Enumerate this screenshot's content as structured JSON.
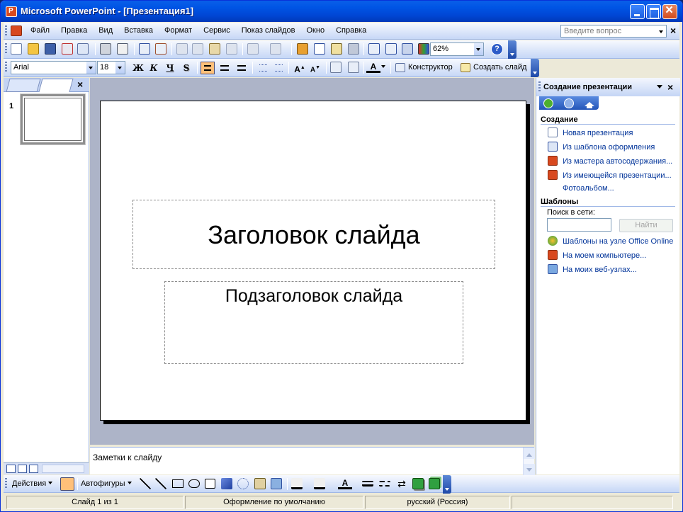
{
  "window": {
    "title": "Microsoft PowerPoint - [Презентация1]"
  },
  "menu": {
    "items": [
      "Файл",
      "Правка",
      "Вид",
      "Вставка",
      "Формат",
      "Сервис",
      "Показ слайдов",
      "Окно",
      "Справка"
    ],
    "help_placeholder": "Введите вопрос"
  },
  "toolbar": {
    "zoom": "62%",
    "font": "Arial",
    "font_size": "18",
    "bold": "Ж",
    "italic": "К",
    "underline": "Ч",
    "shadow": "S",
    "design_label": "Конструктор",
    "new_slide_label": "Создать слайд"
  },
  "slides_pane": {
    "slide_number": "1"
  },
  "slide": {
    "title_placeholder": "Заголовок слайда",
    "subtitle_placeholder": "Подзаголовок слайда"
  },
  "notes": {
    "placeholder": "Заметки к слайду"
  },
  "task_pane": {
    "title": "Создание презентации",
    "create_section": "Создание",
    "create_links": [
      "Новая презентация",
      "Из шаблона оформления",
      "Из мастера автосодержания...",
      "Из имеющейся презентации...",
      "Фотоальбом..."
    ],
    "templates_section": "Шаблоны",
    "search_label": "Поиск в сети:",
    "search_button": "Найти",
    "template_links": [
      "Шаблоны на узле Office Online",
      "На моем компьютере...",
      "На моих веб-узлах..."
    ]
  },
  "drawing_toolbar": {
    "actions": "Действия",
    "autoshapes": "Автофигуры"
  },
  "status": {
    "slide_position": "Слайд 1 из 1",
    "design": "Оформление по умолчанию",
    "language": "русский (Россия)"
  },
  "colors": {
    "title_bar": "#0055E5",
    "toolbar": "#C6D7F6",
    "canvas_bg": "#ADB4C8",
    "link": "#003399"
  }
}
